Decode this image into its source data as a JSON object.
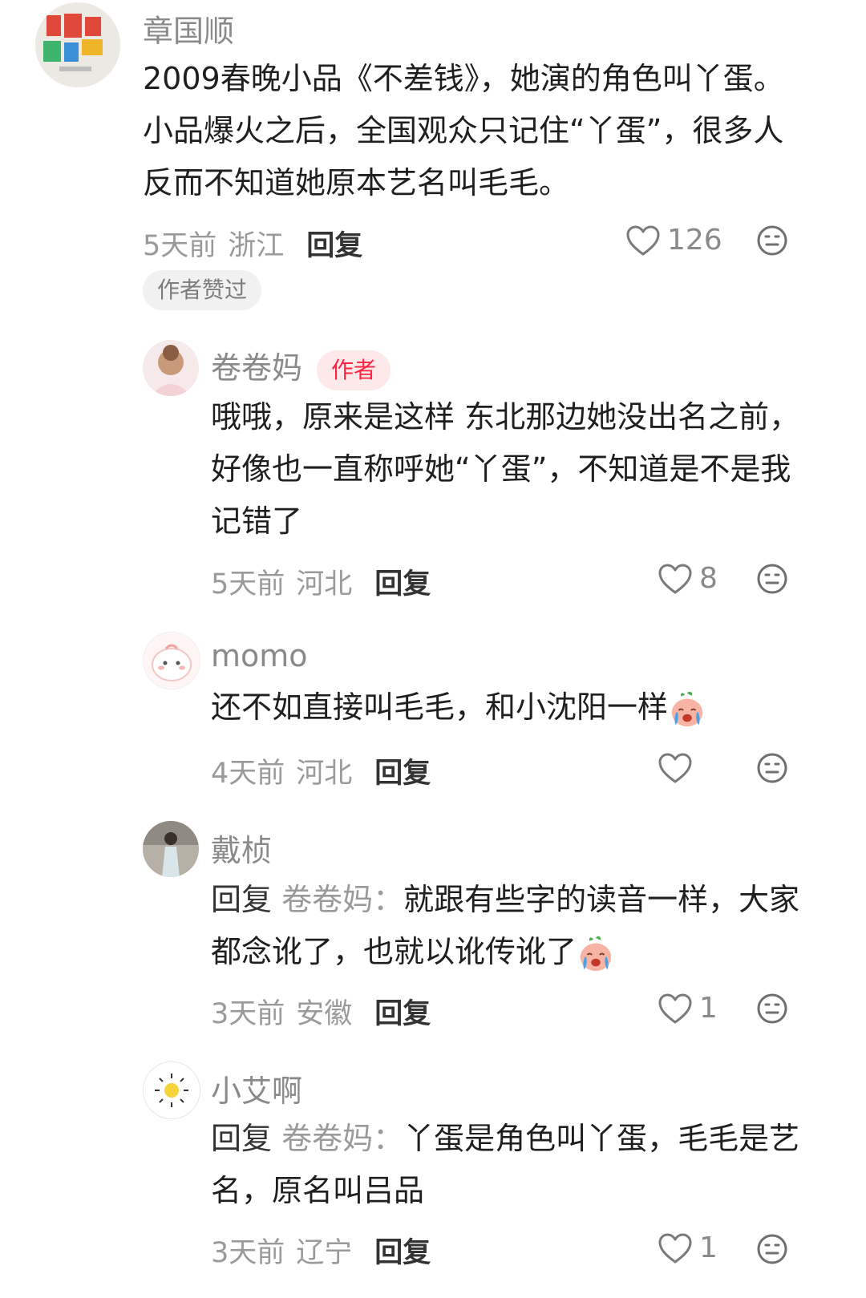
{
  "comments": [
    {
      "username": "章国顺",
      "text": "2009春晚小品《不差钱》，她演的角色叫丫蛋。小品爆火之后，全国观众只记住“丫蛋”，很多人反而不知道她原本艺名叫毛毛。",
      "time": "5天前",
      "location": "浙江",
      "reply_label": "回复",
      "likes": "126",
      "badge": "作者赞过"
    },
    {
      "username": "卷卷妈",
      "author_badge": "作者",
      "text": "哦哦，原来是这样 东北那边她没出名之前，好像也一直称呼她“丫蛋”，不知道是不是我记错了",
      "time": "5天前",
      "location": "河北",
      "reply_label": "回复",
      "likes": "8"
    },
    {
      "username": "momo",
      "text": "还不如直接叫毛毛，和小沈阳一样",
      "emoji": "crying-face-emoji",
      "time": "4天前",
      "location": "河北",
      "reply_label": "回复",
      "likes": ""
    },
    {
      "username": "戴桢",
      "reply_prefix": "回复",
      "reply_target": "卷卷妈：",
      "text": "就跟有些字的读音一样，大家都念讹了，也就以讹传讹了",
      "emoji": "crying-face-emoji",
      "time": "3天前",
      "location": "安徽",
      "reply_label": "回复",
      "likes": "1"
    },
    {
      "username": "小艾啊",
      "reply_prefix": "回复",
      "reply_target": "卷卷妈：",
      "text": "丫蛋是角色叫丫蛋，毛毛是艺名，原名叫吕品",
      "time": "3天前",
      "location": "辽宁",
      "reply_label": "回复",
      "likes": "1"
    }
  ],
  "colors": {
    "accent": "#ff2442",
    "muted": "#9a9a9a",
    "text": "#1f1f1f"
  }
}
